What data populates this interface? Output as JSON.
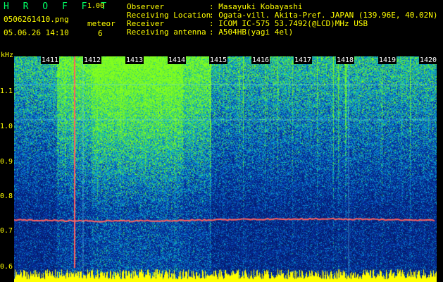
{
  "header": {
    "app_name": "H R O F F T",
    "version": "1.00",
    "filename": "0506261410.png",
    "datetime": "05.06.26 14:10",
    "meteor_label": "meteor",
    "meteor_count": "6"
  },
  "info": [
    {
      "label": "Observer",
      "value": ": Masayuki Kobayashi"
    },
    {
      "label": "Receiving Location",
      "value": ": Ogata-vill. Akita-Pref. JAPAN (139.96E, 40.02N)"
    },
    {
      "label": "Receiver",
      "value": ": ICOM IC-575 53.7492(@LCD)MHz USB"
    },
    {
      "label": "Receiving antenna",
      "value": ": A504HB(yagi 4el)"
    }
  ],
  "yaxis": {
    "unit": "kHz",
    "ticks": [
      "1.1",
      "1.0",
      "0.9",
      "0.8",
      "0.7",
      "0.6"
    ]
  },
  "xaxis": {
    "ticks": [
      "1411",
      "1412",
      "1413",
      "1414",
      "1415",
      "1416",
      "1417",
      "1418",
      "1419",
      "1420"
    ]
  },
  "colors": {
    "text": "#ffff00",
    "background": "#000000",
    "spectrum_low": "#0a1a6e",
    "spectrum_high": "#55ff55",
    "echo_line": "#ff6060"
  }
}
